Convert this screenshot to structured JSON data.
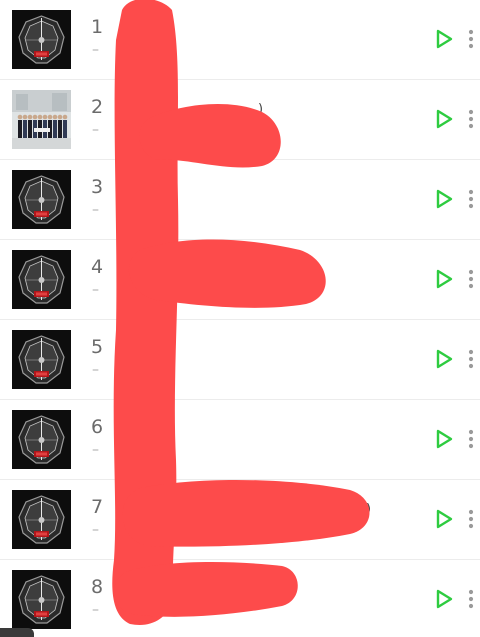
{
  "chart_list": {
    "items": [
      {
        "rank": "1",
        "change": "–",
        "art": "exo-emblem"
      },
      {
        "rank": "2",
        "change": "–",
        "art": "group-photo",
        "title_fragment": ")"
      },
      {
        "rank": "3",
        "change": "–",
        "art": "exo-emblem"
      },
      {
        "rank": "4",
        "change": "–",
        "art": "exo-emblem",
        "title_fragment": ")"
      },
      {
        "rank": "5",
        "change": "–",
        "art": "exo-emblem"
      },
      {
        "rank": "6",
        "change": "–",
        "art": "exo-emblem"
      },
      {
        "rank": "7",
        "change": "–",
        "art": "exo-emblem",
        "title_fragment": ")"
      },
      {
        "rank": "8",
        "change": "–",
        "art": "exo-emblem"
      }
    ]
  },
  "icons": {
    "play": "play-icon",
    "more": "more-vertical-icon"
  },
  "colors": {
    "play_accent": "#2ecc40",
    "redaction": "#fd4b4b",
    "rank_text": "#6b6b6b"
  }
}
